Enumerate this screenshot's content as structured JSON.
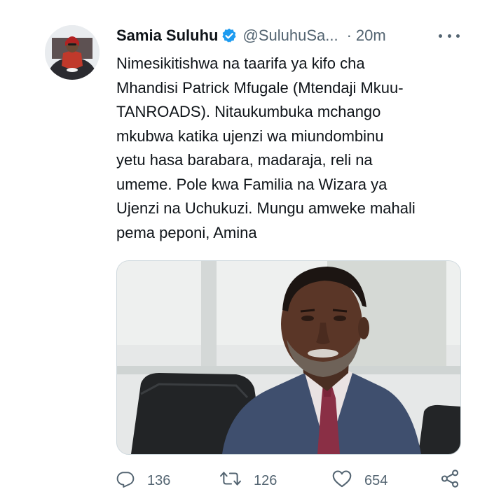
{
  "tweet": {
    "author": {
      "display_name": "Samia Suluhu",
      "handle": "@SuluhuSa...",
      "verified": true,
      "avatar": "avatar-photo"
    },
    "separator": "·",
    "timestamp": "20m",
    "lines": [
      "Nimesikitishwa na taarifa ya kifo cha",
      "Mhandisi Patrick Mfugale (Mtendaji Mkuu-",
      "TANROADS). Nitaukumbuka mchango",
      "mkubwa katika ujenzi wa miundombinu",
      "yetu hasa barabara, madaraja, reli na",
      "umeme. Pole kwa Familia na Wizara ya",
      "Ujenzi na Uchukuzi. Mungu amweke mahali",
      "pema peponi, Amina"
    ],
    "media": "photo-of-man-in-suit",
    "actions": {
      "replies": "136",
      "retweets": "126",
      "likes": "654"
    }
  },
  "colors": {
    "text": "#0f1419",
    "secondary": "#536471",
    "verified": "#1d9bf0",
    "border": "#cfd9de"
  },
  "icons": {
    "more": "more-horizontal-icon",
    "reply": "reply-icon",
    "retweet": "retweet-icon",
    "like": "heart-icon",
    "share": "share-icon",
    "verified": "verified-badge-icon"
  }
}
